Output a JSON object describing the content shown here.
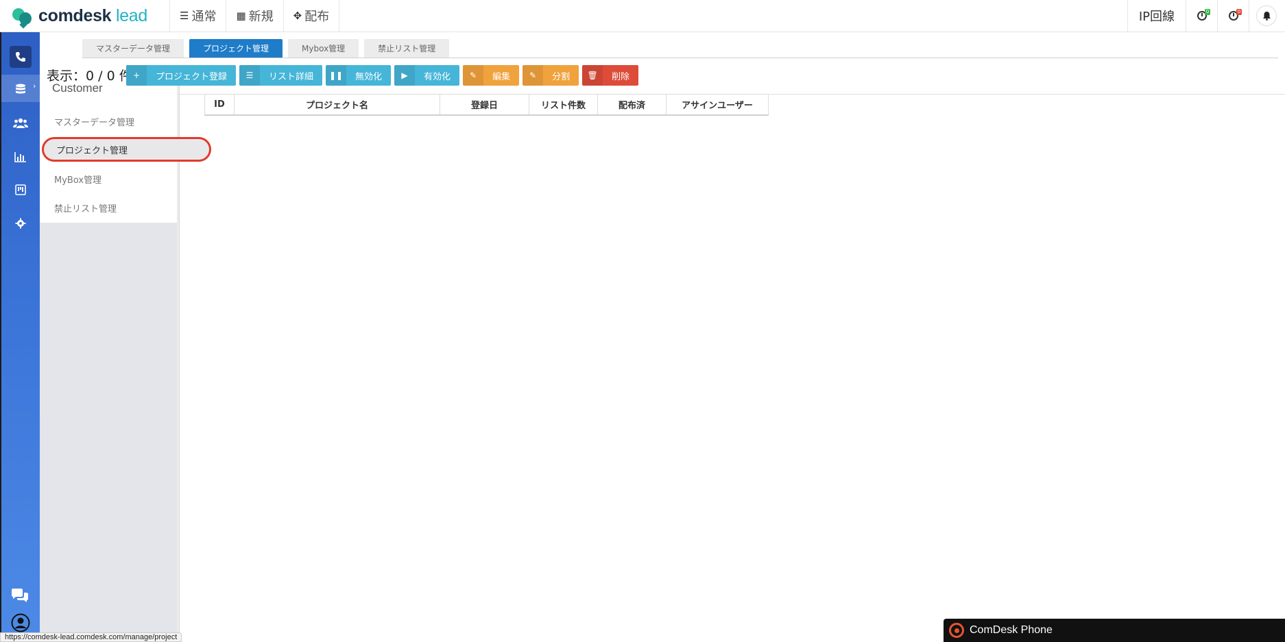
{
  "brand": {
    "name": "comdesk",
    "name_accent": "lead"
  },
  "topnav": [
    {
      "icon": "list-icon",
      "glyph": "☰",
      "label": "通常"
    },
    {
      "icon": "grid-icon",
      "glyph": "▦",
      "label": "新規"
    },
    {
      "icon": "expand-icon",
      "glyph": "✥",
      "label": "配布"
    }
  ],
  "topright": {
    "ip_label": "IP回線",
    "timer1_badge": "0",
    "timer2_badge": "0"
  },
  "submenu": {
    "title": "Customer",
    "items": [
      "マスターデータ管理",
      "プロジェクト管理",
      "MyBox管理",
      "禁止リスト管理"
    ]
  },
  "tabs": [
    "マスターデータ管理",
    "プロジェクト管理",
    "Mybox管理",
    "禁止リスト管理"
  ],
  "count_text": "表示：0 / 0 件",
  "toolbar": [
    {
      "label": "プロジェクト登録",
      "glyph": "+",
      "icon": "plus-icon",
      "style": "info"
    },
    {
      "label": "リスト詳細",
      "glyph": "☰",
      "icon": "list-icon",
      "style": "info"
    },
    {
      "label": "無効化",
      "glyph": "❚❚",
      "icon": "pause-icon",
      "style": "info"
    },
    {
      "label": "有効化",
      "glyph": "▶",
      "icon": "play-icon",
      "style": "info"
    },
    {
      "label": "編集",
      "glyph": "✎",
      "icon": "edit-icon",
      "style": "warn"
    },
    {
      "label": "分割",
      "glyph": "✎",
      "icon": "edit-icon",
      "style": "warn"
    },
    {
      "label": "削除",
      "glyph": "🗑",
      "icon": "trash-icon",
      "style": "danger"
    }
  ],
  "table": {
    "columns": [
      "ID",
      "プロジェクト名",
      "登録日",
      "リスト件数",
      "配布済",
      "アサインユーザー"
    ]
  },
  "status_url": "https://comdesk-lead.comdesk.com/manage/project",
  "phone_widget": {
    "label": "ComDesk Phone"
  },
  "colors": {
    "primary": "#1e7cc8",
    "info": "#45b5d8",
    "warning": "#f0a23c",
    "danger": "#dd4b39",
    "highlight": "#e23a2b"
  }
}
